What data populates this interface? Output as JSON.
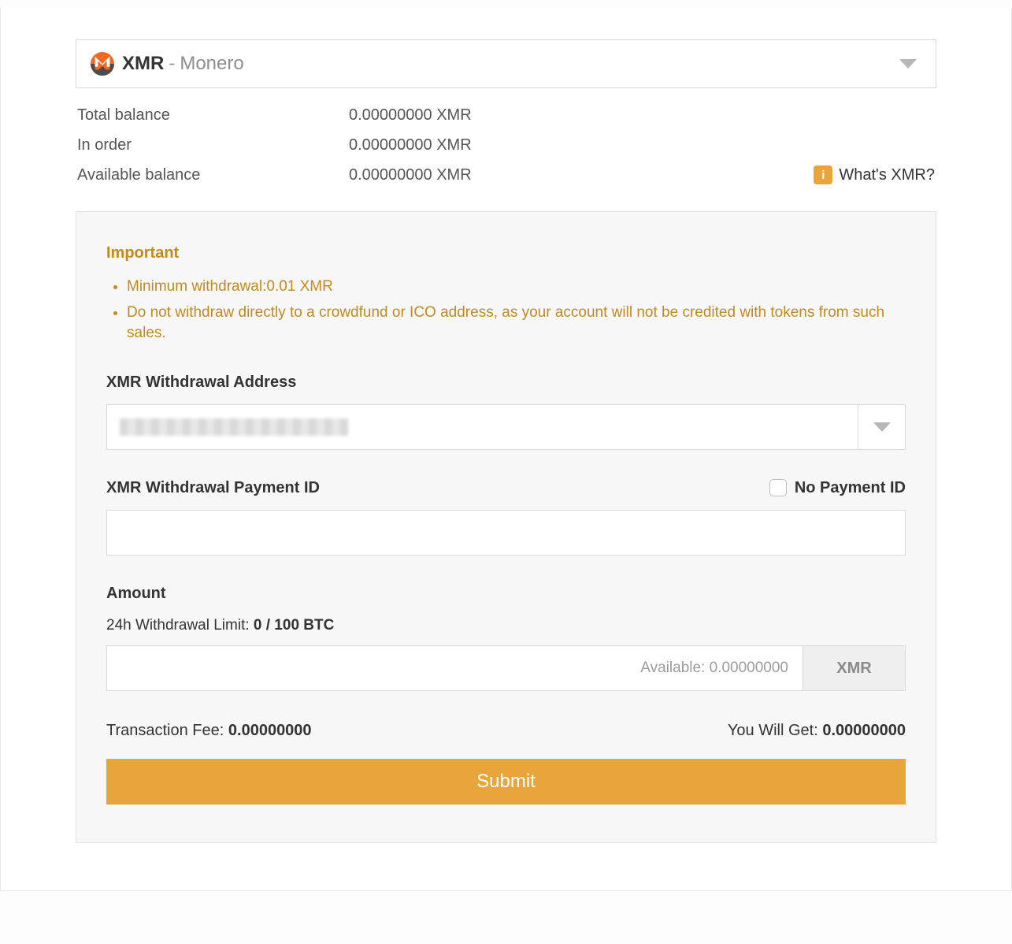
{
  "currency": {
    "symbol": "XMR",
    "separator": "-",
    "name": "Monero",
    "icon": "monero-icon"
  },
  "balances": {
    "total_label": "Total balance",
    "total_value": "0.00000000 XMR",
    "in_order_label": "In order",
    "in_order_value": "0.00000000 XMR",
    "available_label": "Available balance",
    "available_value": "0.00000000 XMR",
    "whats_link": "What's XMR?"
  },
  "panel": {
    "important_title": "Important",
    "warnings": [
      "Minimum withdrawal:0.01 XMR",
      "Do not withdraw directly to a crowdfund or ICO address, as your account will not be credited with tokens from such sales."
    ],
    "address_label": "XMR Withdrawal Address",
    "address_value": "",
    "payment_id_label": "XMR Withdrawal Payment ID",
    "no_payment_id_label": "No Payment ID",
    "payment_id_value": "",
    "amount_label": "Amount",
    "limit_prefix": "24h Withdrawal Limit: ",
    "limit_value": "0 / 100 BTC",
    "amount_placeholder": "Available: 0.00000000",
    "amount_unit": "XMR",
    "fee_label": "Transaction Fee: ",
    "fee_value": "0.00000000",
    "get_label": "You Will Get: ",
    "get_value": "0.00000000",
    "submit_label": "Submit"
  }
}
